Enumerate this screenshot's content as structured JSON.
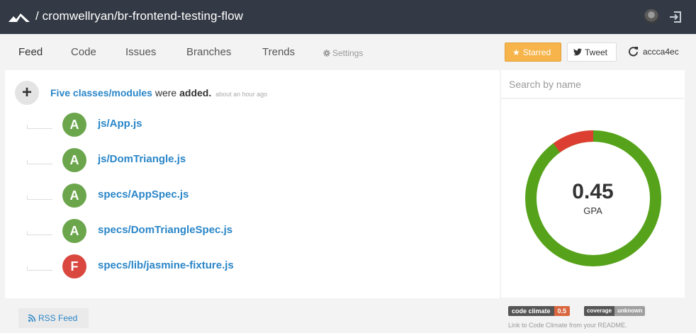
{
  "header": {
    "repo_title": "/ cromwellryan/br-frontend-testing-flow"
  },
  "nav": {
    "tabs": [
      "Feed",
      "Code",
      "Issues",
      "Branches",
      "Trends"
    ],
    "settings": "Settings",
    "starred": "Starred",
    "tweet": "Tweet",
    "commit": "accca4ec"
  },
  "feed": {
    "highlight": "Five classes/modules",
    "middle": "were",
    "action": "added.",
    "time": "about an hour ago",
    "files": [
      {
        "grade": "A",
        "name": "js/App.js"
      },
      {
        "grade": "A",
        "name": "js/DomTriangle.js"
      },
      {
        "grade": "A",
        "name": "specs/AppSpec.js"
      },
      {
        "grade": "A",
        "name": "specs/DomTriangleSpec.js"
      },
      {
        "grade": "F",
        "name": "specs/lib/jasmine-fixture.js"
      }
    ],
    "rss": "RSS Feed"
  },
  "sidebar": {
    "search_placeholder": "Search by name",
    "gpa_value": "0.45",
    "gpa_label": "GPA",
    "gpa_ring": {
      "green_fraction": 0.9,
      "red_fraction": 0.1,
      "green_color": "#56a31b",
      "red_color": "#dd3e32"
    },
    "cc_badge": {
      "left": "code climate",
      "right": "0.5"
    },
    "coverage_badge": {
      "left": "coverage",
      "right": "unknown"
    },
    "readme_note": "Link to Code Climate from your README."
  },
  "colors": {
    "topbar": "#343a45",
    "link": "#2a86c8",
    "grade_A": "#6ba64c",
    "grade_F": "#d9473f",
    "starred": "#f6b44b"
  }
}
